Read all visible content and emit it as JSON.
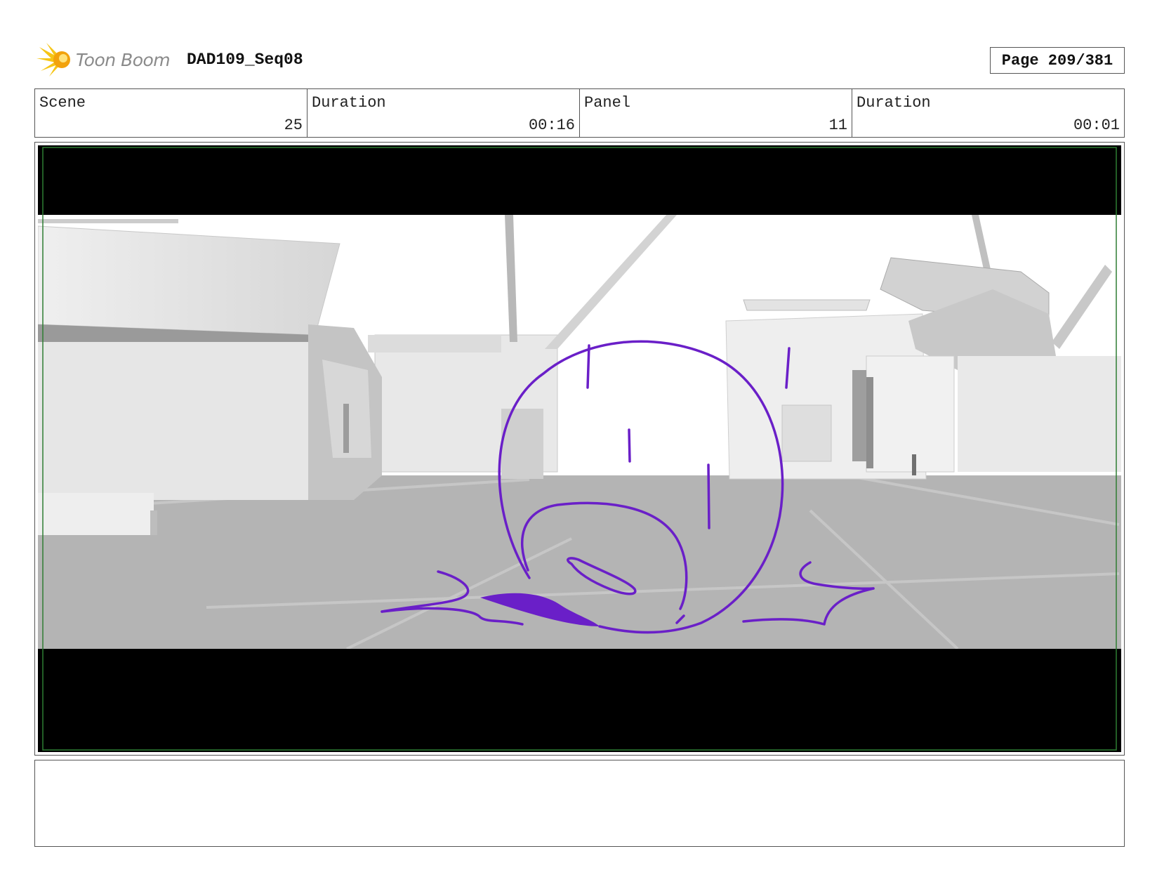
{
  "header": {
    "logo_text": "Toon Boom",
    "project": "DAD109_Seq08",
    "page": "Page 209/381"
  },
  "info": {
    "scene_label": "Scene",
    "scene_value": "25",
    "scene_duration_label": "Duration",
    "scene_duration_value": "00:16",
    "panel_label": "Panel",
    "panel_value": "11",
    "panel_duration_label": "Duration",
    "panel_duration_value": "00:01"
  },
  "panel": {
    "sketch_color": "#6a1fc8",
    "safe_frame_color": "#2e7d32"
  },
  "notes": {
    "text": ""
  }
}
